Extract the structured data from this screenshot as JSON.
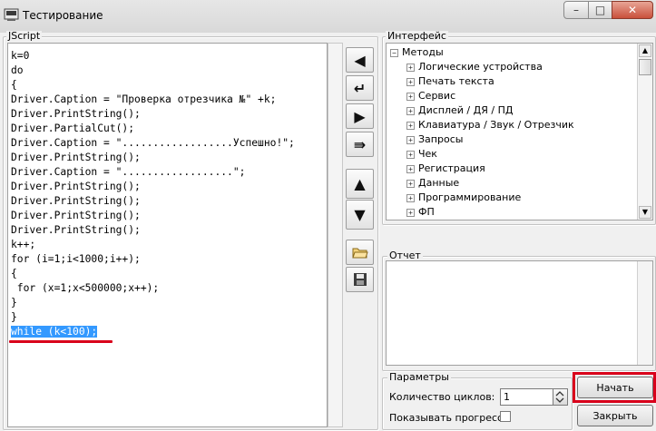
{
  "window": {
    "title": "Тестирование",
    "buttons": {
      "minimize": "–",
      "maximize": "□",
      "close": "✕"
    }
  },
  "editor": {
    "group_label": "JScript",
    "lines": [
      "k=0",
      "do",
      "{",
      "Driver.Caption = \"Проверка отрезчика №\" +k;",
      "Driver.PrintString();",
      "Driver.PartialCut();",
      "Driver.Caption = \"..................Успешно!\";",
      "Driver.PrintString();",
      "Driver.Caption = \"..................\";",
      "Driver.PrintString();",
      "Driver.PrintString();",
      "Driver.PrintString();",
      "Driver.PrintString();",
      "k++;",
      "for (i=1;i<1000;i++);",
      "{",
      " for (x=1;x<500000;x++);",
      "}",
      "}"
    ],
    "selected_line": "while (k<100);"
  },
  "toolbar": {
    "icons": [
      "arrow-left-icon",
      "enter-arrow-icon",
      "arrow-right-icon",
      "double-arrow-right-icon",
      "arrow-up-icon",
      "arrow-down-icon",
      "open-folder-icon",
      "save-disk-icon"
    ],
    "glyphs": {
      "left": "◀",
      "enter": "↵",
      "right": "▶",
      "double_right": "⇛",
      "up": "▲",
      "down": "▼"
    }
  },
  "interface": {
    "group_label": "Интерфейс",
    "root": "Методы",
    "items": [
      "Логические устройства",
      "Печать текста",
      "Сервис",
      "Дисплей / ДЯ / ПД",
      "Клавиатура / Звук / Отрезчик",
      "Запросы",
      "Чек",
      "Регистрация",
      "Данные",
      "Программирование",
      "ФП"
    ]
  },
  "report": {
    "group_label": "Отчет"
  },
  "params": {
    "group_label": "Параметры",
    "cycles_label": "Количество циклов:",
    "cycles_value": "1",
    "progress_label": "Показывать прогресс"
  },
  "actions": {
    "start": "Начать",
    "close": "Закрыть"
  },
  "colors": {
    "selection": "#3399ff",
    "annotation_red": "#d9001b"
  }
}
